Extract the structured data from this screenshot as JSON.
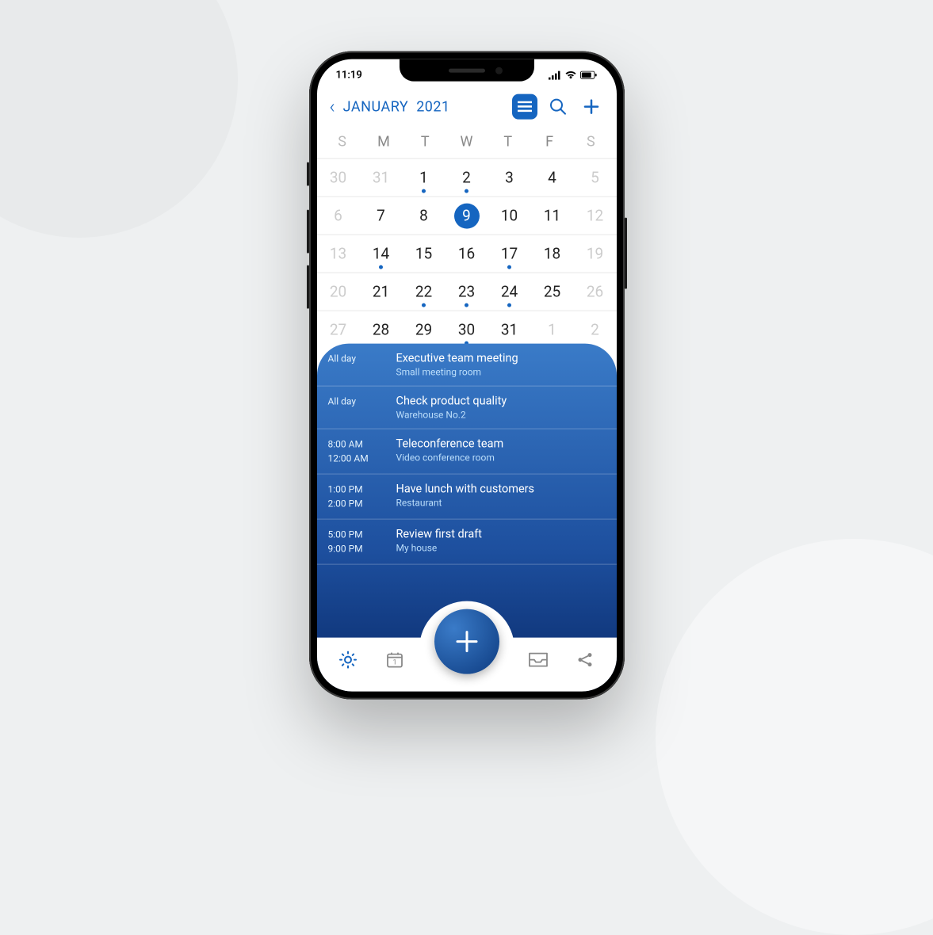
{
  "status": {
    "time": "11:19"
  },
  "header": {
    "month": "JANUARY",
    "year": "2021"
  },
  "weekdays": [
    "S",
    "M",
    "T",
    "W",
    "T",
    "F",
    "S"
  ],
  "calendar": [
    [
      {
        "n": "30",
        "o": true
      },
      {
        "n": "31",
        "o": true
      },
      {
        "n": "1",
        "d": true
      },
      {
        "n": "2",
        "d": true
      },
      {
        "n": "3"
      },
      {
        "n": "4"
      },
      {
        "n": "5",
        "o": true
      }
    ],
    [
      {
        "n": "6",
        "o": true
      },
      {
        "n": "7"
      },
      {
        "n": "8"
      },
      {
        "n": "9",
        "sel": true
      },
      {
        "n": "10"
      },
      {
        "n": "11"
      },
      {
        "n": "12",
        "o": true
      }
    ],
    [
      {
        "n": "13",
        "o": true
      },
      {
        "n": "14",
        "d": true
      },
      {
        "n": "15"
      },
      {
        "n": "16"
      },
      {
        "n": "17",
        "d": true
      },
      {
        "n": "18"
      },
      {
        "n": "19",
        "o": true
      }
    ],
    [
      {
        "n": "20",
        "o": true
      },
      {
        "n": "21"
      },
      {
        "n": "22",
        "d": true
      },
      {
        "n": "23",
        "d": true
      },
      {
        "n": "24",
        "d": true
      },
      {
        "n": "25"
      },
      {
        "n": "26",
        "o": true
      }
    ],
    [
      {
        "n": "27",
        "o": true
      },
      {
        "n": "28"
      },
      {
        "n": "29"
      },
      {
        "n": "30",
        "d": true
      },
      {
        "n": "31"
      },
      {
        "n": "1",
        "o": true
      },
      {
        "n": "2",
        "o": true
      }
    ]
  ],
  "events": [
    {
      "time1": "All day",
      "time2": "",
      "title": "Executive team meeting",
      "loc": "Small meeting room"
    },
    {
      "time1": "All day",
      "time2": "",
      "title": "Check product quality",
      "loc": "Warehouse  No.2"
    },
    {
      "time1": "8:00 AM",
      "time2": "12:00 AM",
      "title": "Teleconference team",
      "loc": "Video conference room"
    },
    {
      "time1": "1:00 PM",
      "time2": "2:00 PM",
      "title": "Have lunch with customers",
      "loc": "Restaurant"
    },
    {
      "time1": "5:00 PM",
      "time2": "9:00 PM",
      "title": "Review first draft",
      "loc": "My house"
    }
  ],
  "bottom_cal_num": "1"
}
